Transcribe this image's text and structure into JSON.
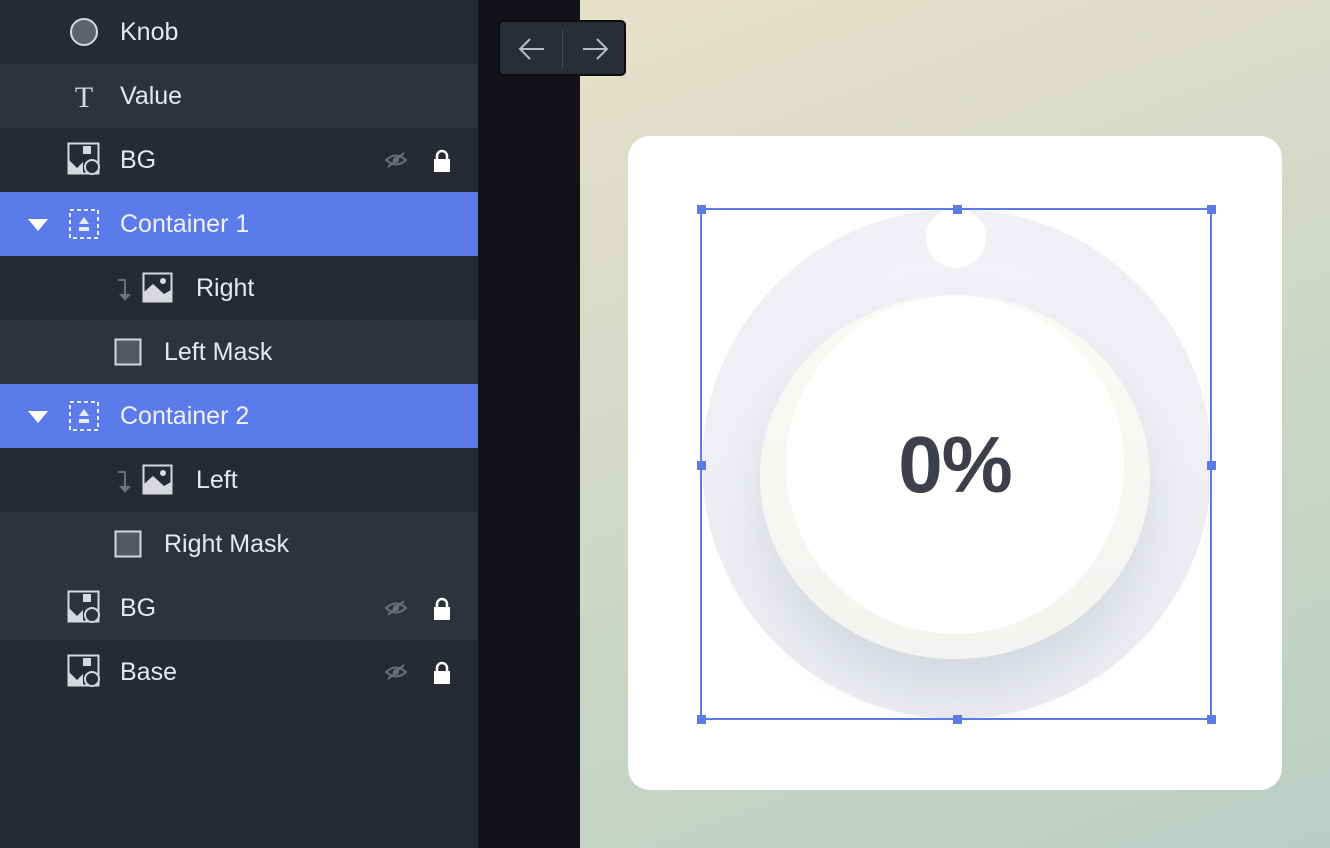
{
  "layers": [
    {
      "label": "Knob",
      "icon": "circle-icon",
      "style": "normal"
    },
    {
      "label": "Value",
      "icon": "text-icon",
      "style": "alt"
    },
    {
      "label": "BG",
      "icon": "image-shape-icon",
      "style": "normal",
      "hidden": true,
      "locked": true
    },
    {
      "label": "Container 1",
      "icon": "container-icon",
      "style": "selected",
      "expanded": true
    },
    {
      "label": "Right",
      "icon": "picture-icon",
      "style": "normal",
      "masked": true
    },
    {
      "label": "Left Mask",
      "icon": "square-icon",
      "style": "alt"
    },
    {
      "label": "Container 2",
      "icon": "container-icon",
      "style": "selected",
      "expanded": true
    },
    {
      "label": "Left",
      "icon": "picture-icon",
      "style": "normal",
      "masked": true
    },
    {
      "label": "Right Mask",
      "icon": "square-icon",
      "style": "alt"
    },
    {
      "label": "BG",
      "icon": "image-shape-icon",
      "style": "alt",
      "hidden": true,
      "locked": true
    },
    {
      "label": "Base",
      "icon": "image-shape-icon",
      "style": "normal",
      "hidden": true,
      "locked": true
    }
  ],
  "history": {
    "back_icon": "arrow-left-icon",
    "forward_icon": "arrow-right-icon"
  },
  "canvas": {
    "value_text": "0%",
    "progress_percent": 0
  },
  "colors": {
    "panel_bg": "#272a33",
    "row_alt_bg": "#2e323c",
    "selected_bg": "#5b7bea",
    "selection_outline": "#5b7bea",
    "value_text": "#3d404a",
    "card_bg": "#ffffff"
  }
}
